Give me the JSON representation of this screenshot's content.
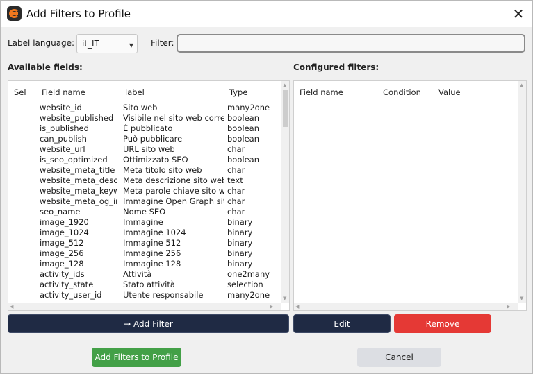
{
  "window": {
    "title": "Add Filters to Profile",
    "close_glyph": "✕"
  },
  "label_language": {
    "label": "Label language:",
    "value": "it_IT"
  },
  "filter": {
    "label": "Filter:",
    "value": "",
    "placeholder": ""
  },
  "available": {
    "heading": "Available fields:",
    "columns": {
      "sel": "Sel",
      "field_name": "Field name",
      "label": "label",
      "type": "Type"
    },
    "rows": [
      {
        "name": "website_id",
        "label": "Sito web",
        "type": "many2one"
      },
      {
        "name": "website_published",
        "label": "Visibile nel sito web corrente",
        "type": "boolean"
      },
      {
        "name": "is_published",
        "label": "È pubblicato",
        "type": "boolean"
      },
      {
        "name": "can_publish",
        "label": "Può pubblicare",
        "type": "boolean"
      },
      {
        "name": "website_url",
        "label": "URL sito web",
        "type": "char"
      },
      {
        "name": "is_seo_optimized",
        "label": "Ottimizzato SEO",
        "type": "boolean"
      },
      {
        "name": "website_meta_title",
        "label": "Meta titolo sito web",
        "type": "char"
      },
      {
        "name": "website_meta_description",
        "label": "Meta descrizione sito web",
        "type": "text"
      },
      {
        "name": "website_meta_keywords",
        "label": "Meta parole chiave sito web",
        "type": "char"
      },
      {
        "name": "website_meta_og_img",
        "label": "Immagine Open Graph sito web",
        "type": "char"
      },
      {
        "name": "seo_name",
        "label": "Nome SEO",
        "type": "char"
      },
      {
        "name": "image_1920",
        "label": "Immagine",
        "type": "binary"
      },
      {
        "name": "image_1024",
        "label": "Immagine 1024",
        "type": "binary"
      },
      {
        "name": "image_512",
        "label": "Immagine 512",
        "type": "binary"
      },
      {
        "name": "image_256",
        "label": "Immagine 256",
        "type": "binary"
      },
      {
        "name": "image_128",
        "label": "Immagine 128",
        "type": "binary"
      },
      {
        "name": "activity_ids",
        "label": "Attività",
        "type": "one2many"
      },
      {
        "name": "activity_state",
        "label": "Stato attività",
        "type": "selection"
      },
      {
        "name": "activity_user_id",
        "label": "Utente responsabile",
        "type": "many2one"
      }
    ]
  },
  "configured": {
    "heading": "Configured filters:",
    "columns": {
      "field_name": "Field name",
      "condition": "Condition",
      "value": "Value"
    }
  },
  "buttons": {
    "add_filter": "→ Add Filter",
    "edit": "Edit",
    "remove": "Remove",
    "add_to_profile": "Add Filters to Profile",
    "cancel": "Cancel"
  },
  "colors": {
    "dark_button": "#1f2a44",
    "remove_button": "#e53935",
    "add_profile_button": "#43a047",
    "cancel_button": "#dcdee3"
  }
}
